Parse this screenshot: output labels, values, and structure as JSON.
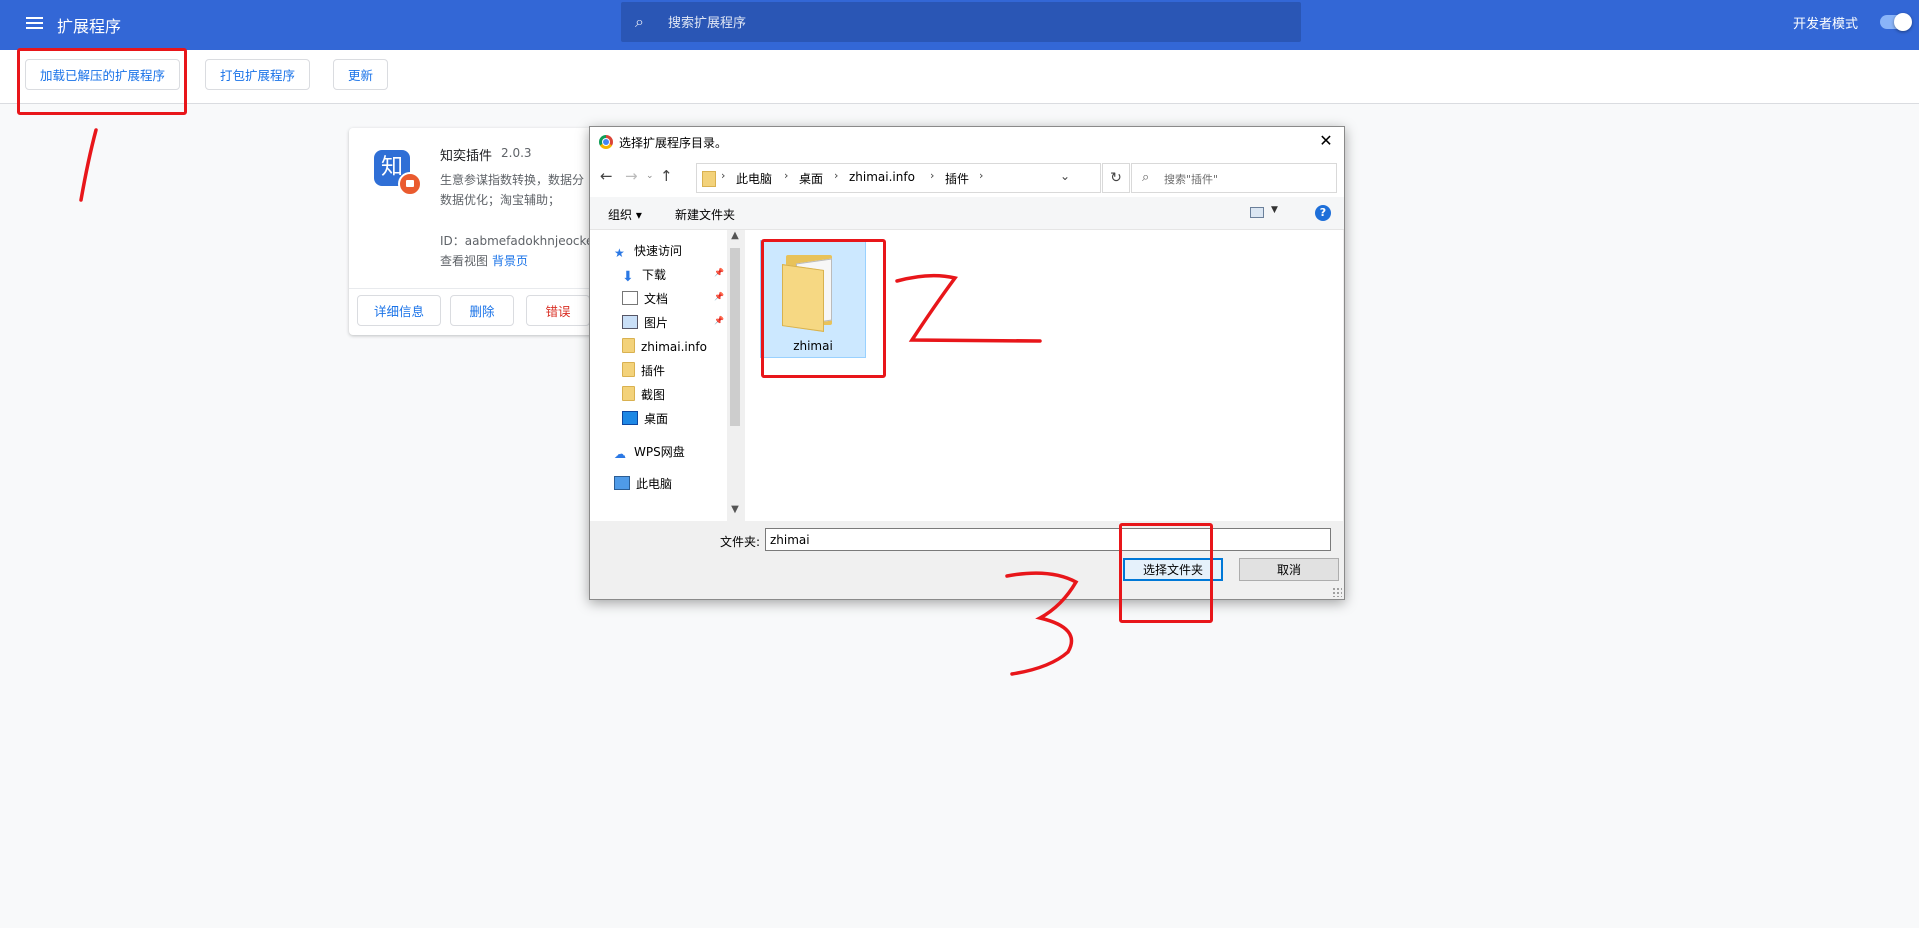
{
  "header": {
    "title": "扩展程序",
    "search_placeholder": "搜索扩展程序",
    "dev_mode_label": "开发者模式"
  },
  "toolbar": {
    "load_unpacked": "加载已解压的扩展程序",
    "pack": "打包扩展程序",
    "update": "更新"
  },
  "extension": {
    "name": "知奕插件",
    "version": "2.0.3",
    "desc_line1": "生意参谋指数转换，数据分",
    "desc_line2": "数据优化；淘宝辅助；",
    "id_text": "ID：aabmefadokhnjeocke",
    "views_label": "查看视图",
    "views_link": "背景页",
    "details": "详细信息",
    "remove": "删除",
    "errors": "错误",
    "icon_char": "知"
  },
  "dialog": {
    "title": "选择扩展程序目录。",
    "breadcrumb": [
      "此电脑",
      "桌面",
      "zhimai.info",
      "插件"
    ],
    "search_placeholder": "搜索\"插件\"",
    "organize": "组织 ▾",
    "new_folder": "新建文件夹",
    "nav": {
      "quick_access": "快速访问",
      "downloads": "下载",
      "documents": "文档",
      "pictures": "图片",
      "zhimai": "zhimai.info",
      "plugins": "插件",
      "screenshots": "截图",
      "desktop": "桌面",
      "wps": "WPS网盘",
      "this_pc": "此电脑"
    },
    "folder_item": "zhimai",
    "folder_label": "文件夹:",
    "folder_value": "zhimai",
    "select_btn": "选择文件夹",
    "cancel_btn": "取消"
  },
  "annotations": {
    "color": "#e8161a",
    "step_marks": [
      "1",
      "2",
      "3"
    ]
  }
}
